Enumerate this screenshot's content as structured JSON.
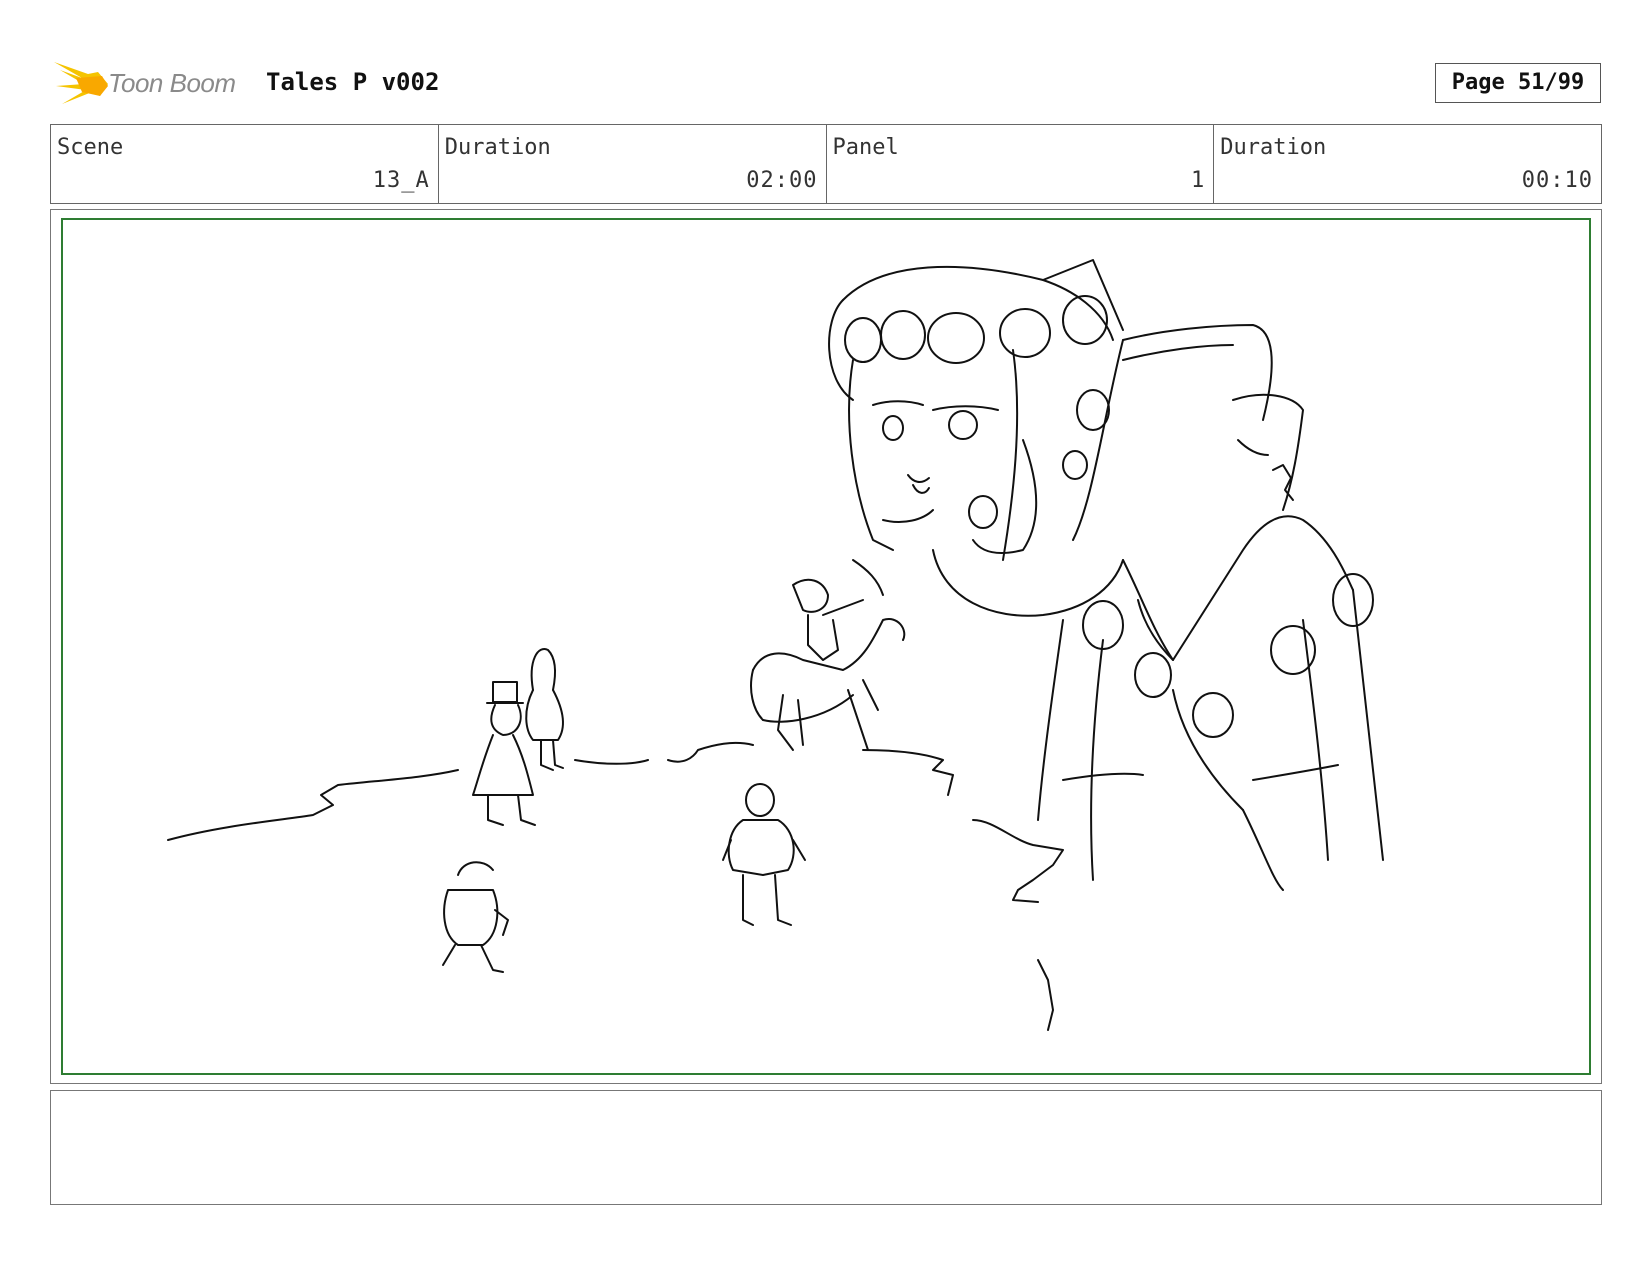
{
  "header": {
    "brand": "Toon Boom",
    "title": "Tales P v002",
    "page": "Page 51/99"
  },
  "info": {
    "scene_label": "Scene",
    "scene_value": "13_A",
    "scene_duration_label": "Duration",
    "scene_duration_value": "02:00",
    "panel_label": "Panel",
    "panel_value": "1",
    "panel_duration_label": "Duration",
    "panel_duration_value": "00:10"
  },
  "colors": {
    "panel_border": "#2e7d32",
    "logo_flame": "#f5c400"
  },
  "notes": ""
}
